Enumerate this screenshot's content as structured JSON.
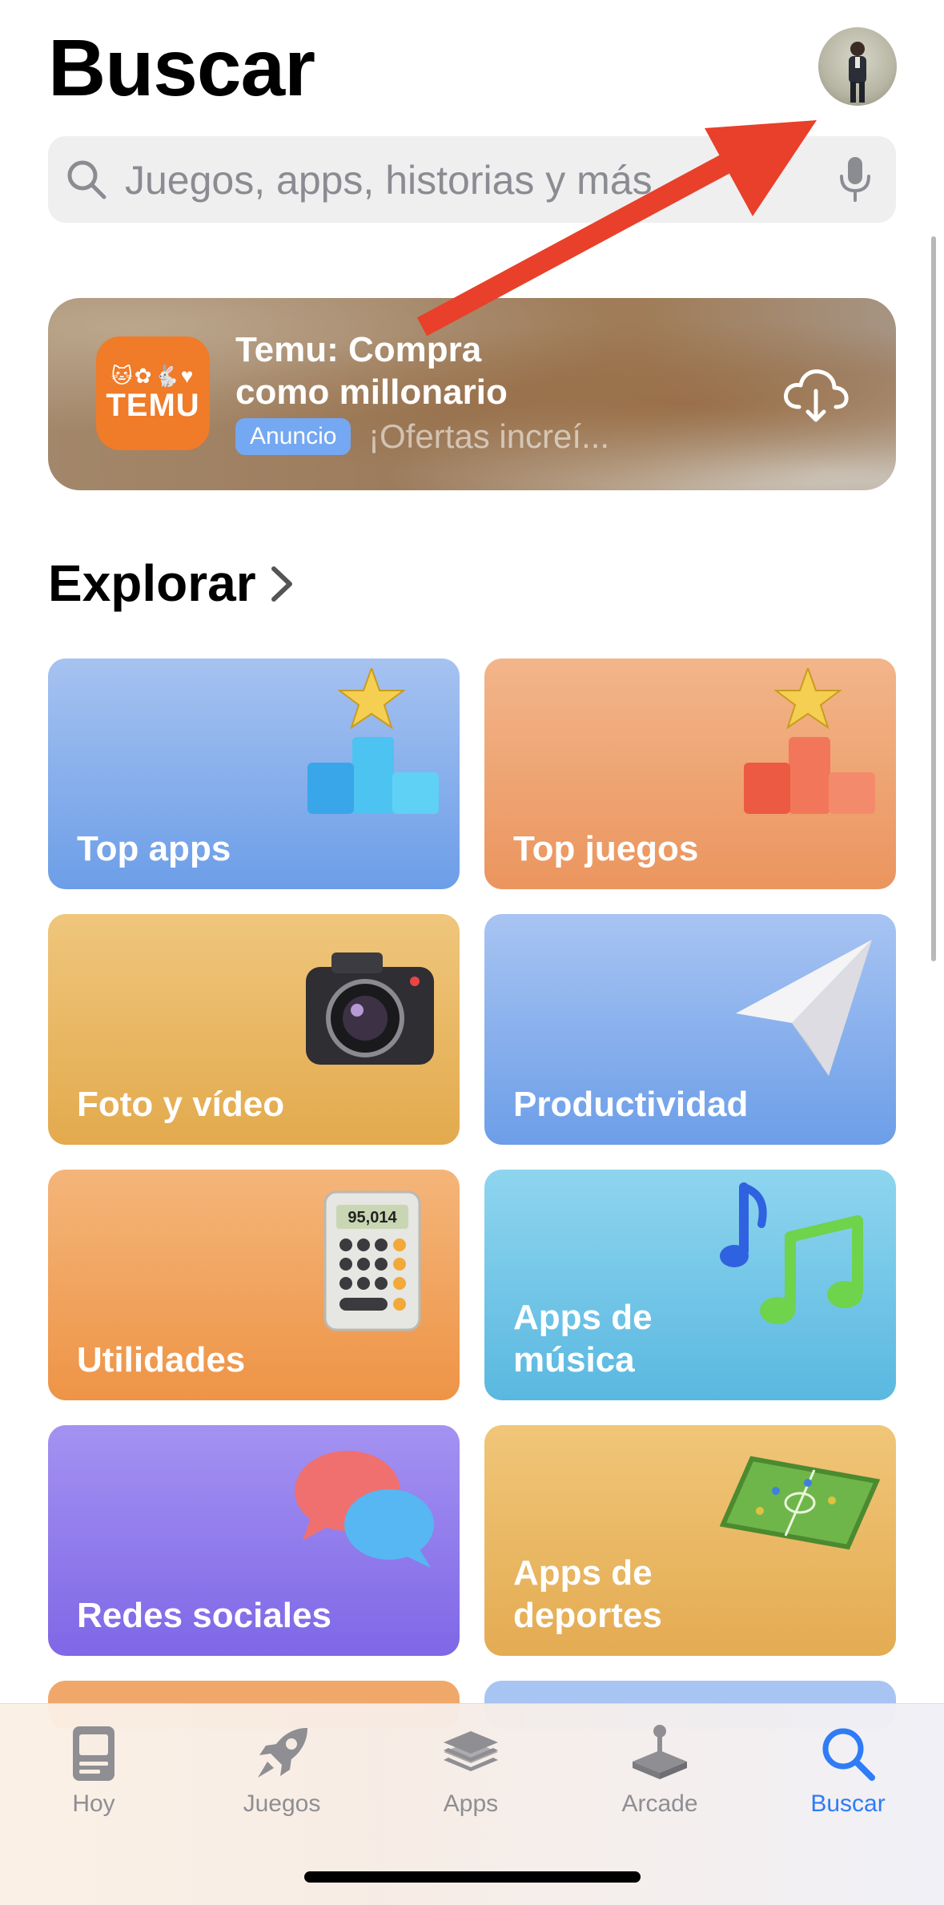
{
  "header": {
    "title": "Buscar"
  },
  "search": {
    "placeholder": "Juegos, apps, historias y más"
  },
  "ad": {
    "brand": "TEMU",
    "title": "Temu: Compra como millonario",
    "badge": "Anuncio",
    "subtitle": "¡Ofertas increí..."
  },
  "explore": {
    "title": "Explorar",
    "categories": [
      {
        "label": "Top apps"
      },
      {
        "label": "Top juegos"
      },
      {
        "label": "Foto y vídeo"
      },
      {
        "label": "Productividad"
      },
      {
        "label": "Utilidades"
      },
      {
        "label": "Apps de música"
      },
      {
        "label": "Redes sociales"
      },
      {
        "label": "Apps de deportes"
      }
    ]
  },
  "tabbar": {
    "items": [
      {
        "label": "Hoy",
        "icon": "today-icon"
      },
      {
        "label": "Juegos",
        "icon": "rocket-icon"
      },
      {
        "label": "Apps",
        "icon": "layers-icon"
      },
      {
        "label": "Arcade",
        "icon": "joystick-icon"
      },
      {
        "label": "Buscar",
        "icon": "search-icon",
        "active": true
      }
    ]
  },
  "colors": {
    "accent": "#2f7cf6",
    "annotation_arrow": "#e8402a",
    "temu_orange": "#f07b28"
  }
}
